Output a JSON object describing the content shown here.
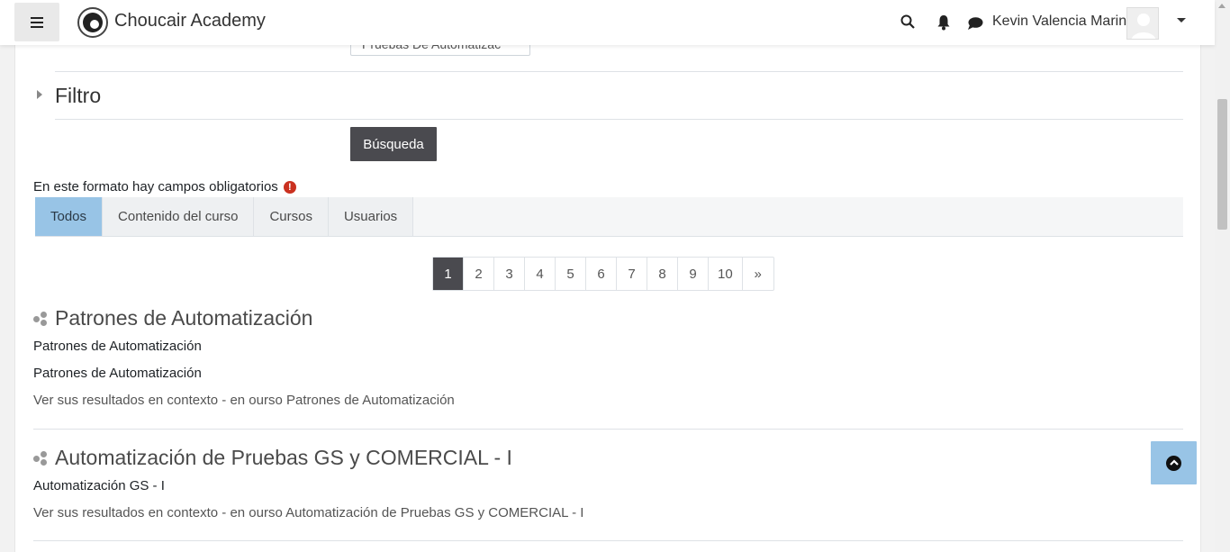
{
  "navbar": {
    "brand": "Choucair Academy",
    "user_name": "Kevin Valencia Marin"
  },
  "form": {
    "select_peek": "Pruebas De Automatizac",
    "filter_title": "Filtro",
    "search_button": "Búsqueda",
    "required_note": "En este formato hay campos obligatorios"
  },
  "tabs": [
    {
      "label": "Todos",
      "active": true
    },
    {
      "label": "Contenido del curso",
      "active": false
    },
    {
      "label": "Cursos",
      "active": false
    },
    {
      "label": "Usuarios",
      "active": false
    }
  ],
  "pagination": {
    "pages": [
      "1",
      "2",
      "3",
      "4",
      "5",
      "6",
      "7",
      "8",
      "9",
      "10",
      "»"
    ],
    "current": "1"
  },
  "results": [
    {
      "title": "Patrones de Automatización",
      "lines": [
        "Patrones de Automatización",
        "Patrones de Automatización"
      ],
      "context": "Ver sus resultados en contexto - en ourso Patrones de Automatización"
    },
    {
      "title": "Automatización de Pruebas GS y COMERCIAL - I",
      "lines": [
        "Automatización GS - I"
      ],
      "context": "Ver sus resultados en contexto - en ourso Automatización de Pruebas GS y COMERCIAL - I"
    }
  ],
  "colors": {
    "active_tab": "#98c4e6",
    "dark_button": "#4a4a4f",
    "required_icon": "#ca3120"
  }
}
